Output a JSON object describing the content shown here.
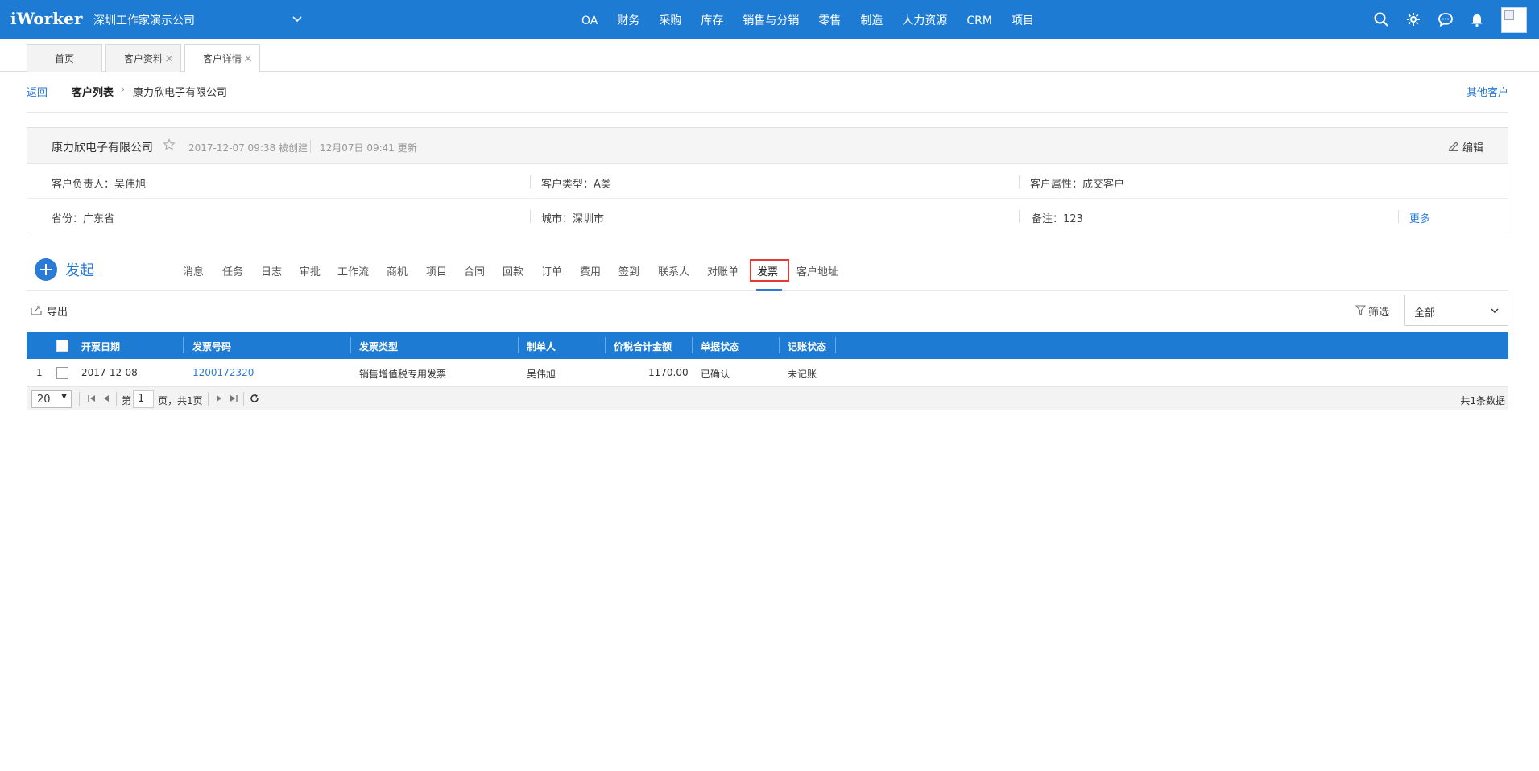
{
  "app": {
    "logo": "iWorker",
    "company": "深圳工作家演示公司"
  },
  "nav": [
    "OA",
    "财务",
    "采购",
    "库存",
    "销售与分销",
    "零售",
    "制造",
    "人力资源",
    "CRM",
    "项目"
  ],
  "tabs": [
    {
      "label": "首页"
    },
    {
      "label": "客户资料",
      "close": "×"
    },
    {
      "label": "客户详情",
      "close": "×"
    }
  ],
  "breadcrumb": {
    "back": "返回",
    "list": "客户列表",
    "sep": "›",
    "current": "康力欣电子有限公司",
    "other": "其他客户"
  },
  "customer": {
    "name": "康力欣电子有限公司",
    "created": "2017-12-07 09:38 被创建",
    "updated": "12月07日 09:41 更新",
    "edit": "编辑",
    "fields": {
      "owner": "客户负责人：吴伟旭",
      "type": "客户类型：A类",
      "attr": "客户属性：成交客户",
      "province": "省份：广东省",
      "city": "城市：深圳市",
      "note": "备注：123"
    },
    "more": "更多"
  },
  "launch": "发起",
  "subtabs": [
    "消息",
    "任务",
    "日志",
    "审批",
    "工作流",
    "商机",
    "项目",
    "合同",
    "回款",
    "订单",
    "费用",
    "签到",
    "联系人",
    "对账单",
    "发票",
    "客户地址"
  ],
  "active_subtab": "发票",
  "toolbar": {
    "export": "导出",
    "filter": "筛选",
    "select_value": "全部"
  },
  "table": {
    "columns": [
      "开票日期",
      "发票号码",
      "发票类型",
      "制单人",
      "价税合计金额",
      "单据状态",
      "记账状态"
    ],
    "rows": [
      {
        "index": "1",
        "date": "2017-12-08",
        "number": "1200172320",
        "type": "销售增值税专用发票",
        "maker": "吴伟旭",
        "amount": "1170.00",
        "status": "已确认",
        "account": "未记账"
      }
    ]
  },
  "pager": {
    "size": "20",
    "page_prefix": "第",
    "page": "1",
    "page_suffix": "页，共1页",
    "total": "共1条数据"
  },
  "colors": {
    "brand": "#1e7bd3",
    "link": "#2a7ad6",
    "highlight": "#e53935"
  }
}
